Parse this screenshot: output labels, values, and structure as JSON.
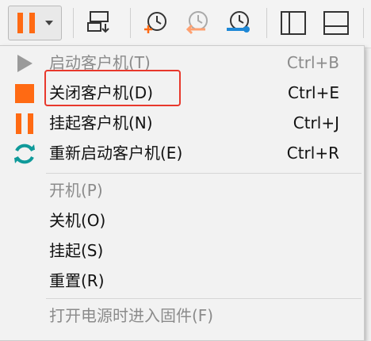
{
  "menu": {
    "items": [
      {
        "label": "启动客户机(T)",
        "accel": "Ctrl+B",
        "icon": "play-icon",
        "enabled": false
      },
      {
        "label": "关闭客户机(D)",
        "accel": "Ctrl+E",
        "icon": "stop-icon",
        "enabled": true
      },
      {
        "label": "挂起客户机(N)",
        "accel": "Ctrl+J",
        "icon": "pause-icon",
        "enabled": true
      },
      {
        "label": "重新启动客户机(E)",
        "accel": "Ctrl+R",
        "icon": "restart-icon",
        "enabled": true
      },
      {
        "label": "开机(P)",
        "accel": "",
        "enabled": false
      },
      {
        "label": "关机(O)",
        "accel": "",
        "enabled": true
      },
      {
        "label": "挂起(S)",
        "accel": "",
        "enabled": true
      },
      {
        "label": "重置(R)",
        "accel": "",
        "enabled": true
      },
      {
        "label": "打开电源时进入固件(F)",
        "accel": "",
        "enabled": false
      }
    ]
  },
  "colors": {
    "accent_orange": "#ff6a13",
    "restart_teal": "#0f9a9a",
    "highlight_red": "#e8382c",
    "disabled_gray": "#8b8b8b"
  }
}
